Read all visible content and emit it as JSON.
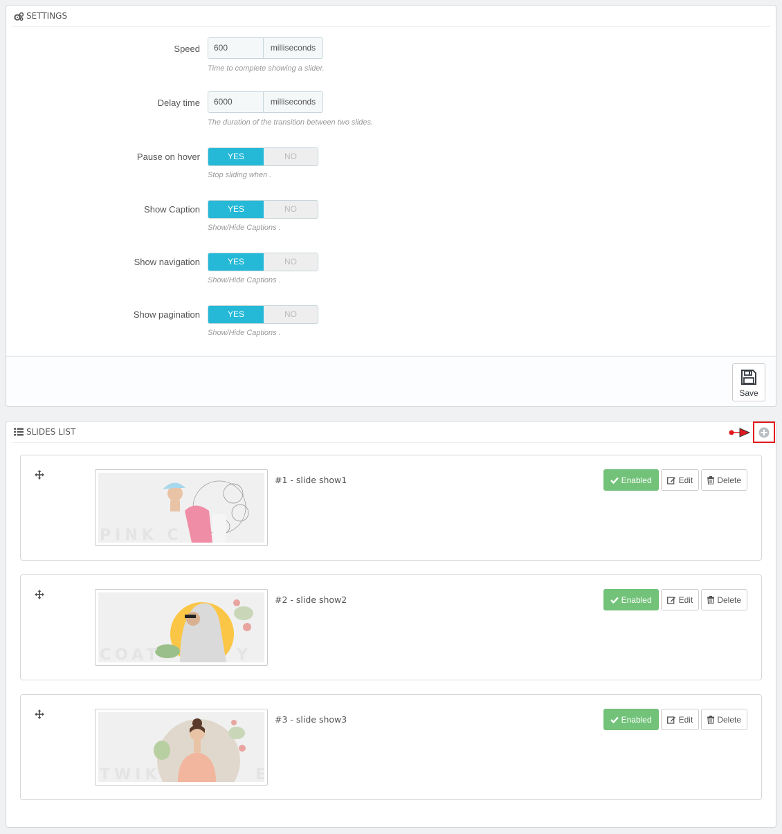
{
  "settings": {
    "heading": "SETTINGS",
    "speed": {
      "label": "Speed",
      "value": "600",
      "unit": "milliseconds",
      "help": "Time to complete showing a slider."
    },
    "delay": {
      "label": "Delay time",
      "value": "6000",
      "unit": "milliseconds",
      "help": "The duration of the transition between two slides."
    },
    "pause": {
      "label": "Pause on hover",
      "yes": "YES",
      "no": "NO",
      "help": "Stop sliding when ."
    },
    "caption": {
      "label": "Show Caption",
      "yes": "YES",
      "no": "NO",
      "help": "Show/Hide Captions ."
    },
    "navigation": {
      "label": "Show navigation",
      "yes": "YES",
      "no": "NO",
      "help": "Show/Hide Captions ."
    },
    "pagination": {
      "label": "Show pagination",
      "yes": "YES",
      "no": "NO",
      "help": "Show/Hide Captions ."
    },
    "save_label": "Save"
  },
  "slides": {
    "heading": "SLIDES LIST",
    "items": [
      {
        "title": "#1 - slide show1",
        "status": "Enabled",
        "edit": "Edit",
        "delete": "Delete",
        "watermark": "PINK C"
      },
      {
        "title": "#2 - slide show2",
        "status": "Enabled",
        "edit": "Edit",
        "delete": "Delete",
        "watermark": "COAT        Y"
      },
      {
        "title": "#3 - slide show3",
        "status": "Enabled",
        "edit": "Edit",
        "delete": "Delete",
        "watermark": "TWIK          E"
      }
    ]
  },
  "colors": {
    "accent": "#25b9d7",
    "enabled": "#72c279",
    "highlight": "#e0181d"
  }
}
